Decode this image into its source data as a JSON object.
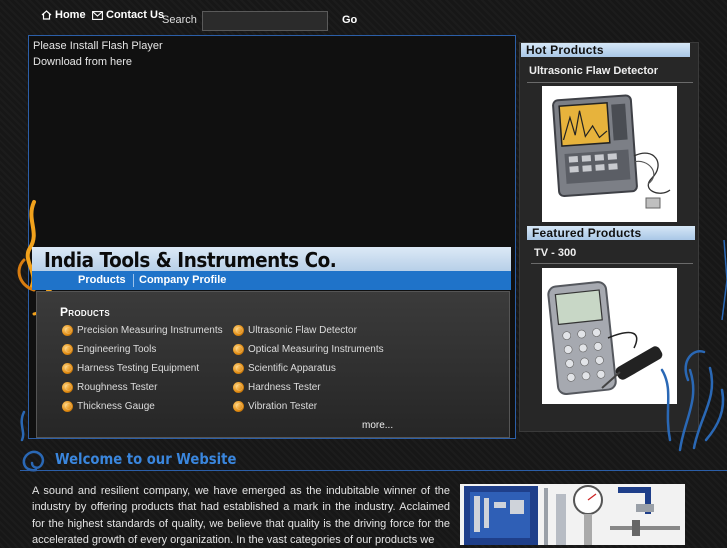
{
  "topnav": {
    "home_label": "Home",
    "contact_label": "Contact Us",
    "search_label": "Search",
    "search_value": "",
    "go_label": "Go"
  },
  "flash": {
    "line1": "Please Install Flash Player",
    "line2": "Download from here"
  },
  "banner": {
    "company_name": "India Tools & Instruments Co.",
    "nav": [
      "Products",
      "Company Profile"
    ]
  },
  "products": {
    "heading": "Products",
    "left": [
      "Precision Measuring Instruments",
      "Engineering Tools",
      "Harness Testing Equipment",
      "Roughness Tester",
      "Thickness Gauge"
    ],
    "right": [
      "Ultrasonic Flaw Detector",
      "Optical Measuring Instruments",
      "Scientific Apparatus",
      "Hardness Tester",
      "Vibration Tester"
    ],
    "more_label": "more..."
  },
  "sidebar": {
    "hot_heading": "Hot Products",
    "hot_item": "Ultrasonic Flaw Detector",
    "featured_heading": "Featured Products",
    "featured_item": "TV - 300"
  },
  "welcome": {
    "title": "Welcome to our Website",
    "text": "A sound and resilient company, we have emerged as the indubitable winner of the industry by offering products that had established a mark in the industry. Acclaimed for the highest standards of quality, we believe that quality is the driving force for the accelerated growth of every organization. In the vast categories of our products we"
  },
  "colors": {
    "accent_blue": "#1f73c9",
    "title_blue": "#3a86dd",
    "bullet_orange": "#e08a10",
    "background": "#171717"
  }
}
